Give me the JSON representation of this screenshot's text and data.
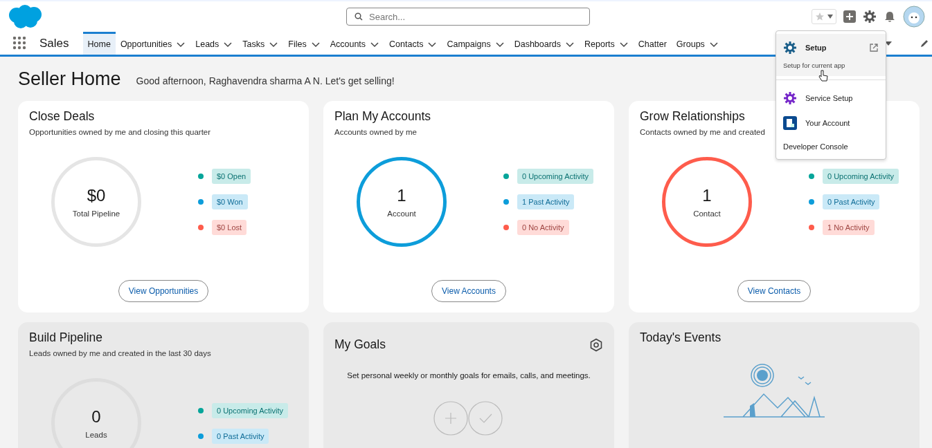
{
  "header": {
    "search": {
      "placeholder": "Search..."
    }
  },
  "nav": {
    "app_name": "Sales",
    "tabs": [
      {
        "label": "Home",
        "selected": true,
        "has_menu": false
      },
      {
        "label": "Opportunities",
        "selected": false,
        "has_menu": true
      },
      {
        "label": "Leads",
        "selected": false,
        "has_menu": true
      },
      {
        "label": "Tasks",
        "selected": false,
        "has_menu": true
      },
      {
        "label": "Files",
        "selected": false,
        "has_menu": true
      },
      {
        "label": "Accounts",
        "selected": false,
        "has_menu": true
      },
      {
        "label": "Contacts",
        "selected": false,
        "has_menu": true
      },
      {
        "label": "Campaigns",
        "selected": false,
        "has_menu": true
      },
      {
        "label": "Dashboards",
        "selected": false,
        "has_menu": true
      },
      {
        "label": "Reports",
        "selected": false,
        "has_menu": true
      },
      {
        "label": "Chatter",
        "selected": false,
        "has_menu": false
      },
      {
        "label": "Groups",
        "selected": false,
        "has_menu": true
      }
    ]
  },
  "setup_menu": {
    "items": [
      {
        "kind": "setup",
        "label": "Setup",
        "subtitle": "Setup for current app",
        "selected": true
      },
      {
        "kind": "service",
        "label": "Service Setup",
        "selected": false
      },
      {
        "kind": "account",
        "label": "Your Account",
        "selected": false
      },
      {
        "kind": "plain",
        "label": "Developer Console",
        "selected": false
      }
    ]
  },
  "page": {
    "title": "Seller Home",
    "greeting": "Good afternoon, Raghavendra sharma A N. Let's get selling!"
  },
  "cards": [
    {
      "kind": "summary",
      "title": "Close Deals",
      "subtitle": "Opportunities owned by me and closing this quarter",
      "ring": {
        "value": "$0",
        "label": "Total Pipeline",
        "color": "#e5e5e5"
      },
      "legend": [
        {
          "label": "$0 Open",
          "color": "#06a59a"
        },
        {
          "label": "$0 Won",
          "color": "#0d9dda"
        },
        {
          "label": "$0 Lost",
          "color": "#fe5c4c"
        }
      ],
      "button": "View Opportunities"
    },
    {
      "kind": "summary",
      "title": "Plan My Accounts",
      "subtitle": "Accounts owned by me",
      "ring": {
        "value": "1",
        "label": "Account",
        "color": "#0d9dda"
      },
      "legend": [
        {
          "label": "0 Upcoming Activity",
          "color": "#06a59a"
        },
        {
          "label": "1 Past Activity",
          "color": "#0d9dda"
        },
        {
          "label": "0 No Activity",
          "color": "#fe5c4c"
        }
      ],
      "button": "View Accounts"
    },
    {
      "kind": "summary",
      "title": "Grow Relationships",
      "subtitle": "Contacts owned by me and created",
      "ring": {
        "value": "1",
        "label": "Contact",
        "color": "#fe5c4c"
      },
      "legend": [
        {
          "label": "0 Upcoming Activity",
          "color": "#06a59a"
        },
        {
          "label": "0 Past Activity",
          "color": "#0d9dda"
        },
        {
          "label": "1 No Activity",
          "color": "#fe5c4c"
        }
      ],
      "button": "View Contacts"
    },
    {
      "kind": "summary",
      "title": "Build Pipeline",
      "subtitle": "Leads owned by me and created in the last 30 days",
      "ring": {
        "value": "0",
        "label": "Leads",
        "color": "#dddddd"
      },
      "legend": [
        {
          "label": "0 Upcoming Activity",
          "color": "#06a59a"
        },
        {
          "label": "0 Past Activity",
          "color": "#0d9dda"
        }
      ]
    },
    {
      "kind": "goals",
      "title": "My Goals",
      "text": "Set personal weekly or monthly goals for emails, calls, and meetings."
    },
    {
      "kind": "events",
      "title": "Today's Events"
    }
  ]
}
